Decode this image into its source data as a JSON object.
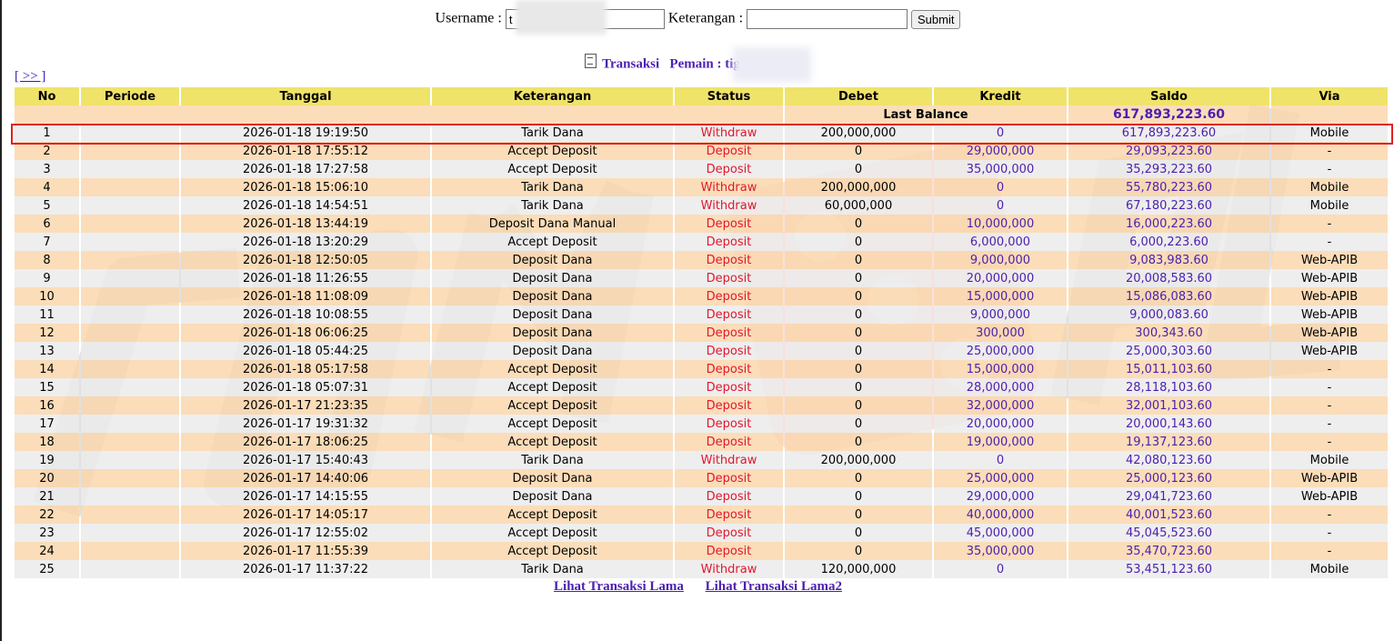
{
  "form": {
    "username_label": "Username :",
    "username_value": "t",
    "keterangan_label": "Keterangan :",
    "keterangan_value": "",
    "submit_label": "Submit"
  },
  "title": {
    "transaksi": "Transaksi",
    "pemain_label": "Pemain : tig"
  },
  "nav": {
    "next_label": "[ >> ]"
  },
  "table": {
    "headers": [
      "No",
      "Periode",
      "Tanggal",
      "Keterangan",
      "Status",
      "Debet",
      "Kredit",
      "Saldo",
      "Via"
    ],
    "last_balance_label": "Last Balance",
    "last_balance_value": "617,893,223.60",
    "rows": [
      {
        "no": "1",
        "periode": "",
        "tanggal": "2026-01-18 19:19:50",
        "ket": "Tarik Dana",
        "status": "Withdraw",
        "debet": "200,000,000",
        "kredit": "0",
        "saldo": "617,893,223.60",
        "via": "Mobile"
      },
      {
        "no": "2",
        "periode": "",
        "tanggal": "2026-01-18 17:55:12",
        "ket": "Accept Deposit",
        "status": "Deposit",
        "debet": "0",
        "kredit": "29,000,000",
        "saldo": "29,093,223.60",
        "via": "-"
      },
      {
        "no": "3",
        "periode": "",
        "tanggal": "2026-01-18 17:27:58",
        "ket": "Accept Deposit",
        "status": "Deposit",
        "debet": "0",
        "kredit": "35,000,000",
        "saldo": "35,293,223.60",
        "via": "-"
      },
      {
        "no": "4",
        "periode": "",
        "tanggal": "2026-01-18 15:06:10",
        "ket": "Tarik Dana",
        "status": "Withdraw",
        "debet": "200,000,000",
        "kredit": "0",
        "saldo": "55,780,223.60",
        "via": "Mobile"
      },
      {
        "no": "5",
        "periode": "",
        "tanggal": "2026-01-18 14:54:51",
        "ket": "Tarik Dana",
        "status": "Withdraw",
        "debet": "60,000,000",
        "kredit": "0",
        "saldo": "67,180,223.60",
        "via": "Mobile"
      },
      {
        "no": "6",
        "periode": "",
        "tanggal": "2026-01-18 13:44:19",
        "ket": "Deposit Dana Manual",
        "status": "Deposit",
        "debet": "0",
        "kredit": "10,000,000",
        "saldo": "16,000,223.60",
        "via": "-"
      },
      {
        "no": "7",
        "periode": "",
        "tanggal": "2026-01-18 13:20:29",
        "ket": "Accept Deposit",
        "status": "Deposit",
        "debet": "0",
        "kredit": "6,000,000",
        "saldo": "6,000,223.60",
        "via": "-"
      },
      {
        "no": "8",
        "periode": "",
        "tanggal": "2026-01-18 12:50:05",
        "ket": "Deposit Dana",
        "status": "Deposit",
        "debet": "0",
        "kredit": "9,000,000",
        "saldo": "9,083,983.60",
        "via": "Web-APIB"
      },
      {
        "no": "9",
        "periode": "",
        "tanggal": "2026-01-18 11:26:55",
        "ket": "Deposit Dana",
        "status": "Deposit",
        "debet": "0",
        "kredit": "20,000,000",
        "saldo": "20,008,583.60",
        "via": "Web-APIB"
      },
      {
        "no": "10",
        "periode": "",
        "tanggal": "2026-01-18 11:08:09",
        "ket": "Deposit Dana",
        "status": "Deposit",
        "debet": "0",
        "kredit": "15,000,000",
        "saldo": "15,086,083.60",
        "via": "Web-APIB"
      },
      {
        "no": "11",
        "periode": "",
        "tanggal": "2026-01-18 10:08:55",
        "ket": "Deposit Dana",
        "status": "Deposit",
        "debet": "0",
        "kredit": "9,000,000",
        "saldo": "9,000,083.60",
        "via": "Web-APIB"
      },
      {
        "no": "12",
        "periode": "",
        "tanggal": "2026-01-18 06:06:25",
        "ket": "Deposit Dana",
        "status": "Deposit",
        "debet": "0",
        "kredit": "300,000",
        "saldo": "300,343.60",
        "via": "Web-APIB"
      },
      {
        "no": "13",
        "periode": "",
        "tanggal": "2026-01-18 05:44:25",
        "ket": "Deposit Dana",
        "status": "Deposit",
        "debet": "0",
        "kredit": "25,000,000",
        "saldo": "25,000,303.60",
        "via": "Web-APIB"
      },
      {
        "no": "14",
        "periode": "",
        "tanggal": "2026-01-18 05:17:58",
        "ket": "Accept Deposit",
        "status": "Deposit",
        "debet": "0",
        "kredit": "15,000,000",
        "saldo": "15,011,103.60",
        "via": "-"
      },
      {
        "no": "15",
        "periode": "",
        "tanggal": "2026-01-18 05:07:31",
        "ket": "Accept Deposit",
        "status": "Deposit",
        "debet": "0",
        "kredit": "28,000,000",
        "saldo": "28,118,103.60",
        "via": "-"
      },
      {
        "no": "16",
        "periode": "",
        "tanggal": "2026-01-17 21:23:35",
        "ket": "Accept Deposit",
        "status": "Deposit",
        "debet": "0",
        "kredit": "32,000,000",
        "saldo": "32,001,103.60",
        "via": "-"
      },
      {
        "no": "17",
        "periode": "",
        "tanggal": "2026-01-17 19:31:32",
        "ket": "Accept Deposit",
        "status": "Deposit",
        "debet": "0",
        "kredit": "20,000,000",
        "saldo": "20,000,143.60",
        "via": "-"
      },
      {
        "no": "18",
        "periode": "",
        "tanggal": "2026-01-17 18:06:25",
        "ket": "Accept Deposit",
        "status": "Deposit",
        "debet": "0",
        "kredit": "19,000,000",
        "saldo": "19,137,123.60",
        "via": "-"
      },
      {
        "no": "19",
        "periode": "",
        "tanggal": "2026-01-17 15:40:43",
        "ket": "Tarik Dana",
        "status": "Withdraw",
        "debet": "200,000,000",
        "kredit": "0",
        "saldo": "42,080,123.60",
        "via": "Mobile"
      },
      {
        "no": "20",
        "periode": "",
        "tanggal": "2026-01-17 14:40:06",
        "ket": "Deposit Dana",
        "status": "Deposit",
        "debet": "0",
        "kredit": "25,000,000",
        "saldo": "25,000,123.60",
        "via": "Web-APIB"
      },
      {
        "no": "21",
        "periode": "",
        "tanggal": "2026-01-17 14:15:55",
        "ket": "Deposit Dana",
        "status": "Deposit",
        "debet": "0",
        "kredit": "29,000,000",
        "saldo": "29,041,723.60",
        "via": "Web-APIB"
      },
      {
        "no": "22",
        "periode": "",
        "tanggal": "2026-01-17 14:05:17",
        "ket": "Accept Deposit",
        "status": "Deposit",
        "debet": "0",
        "kredit": "40,000,000",
        "saldo": "40,001,523.60",
        "via": "-"
      },
      {
        "no": "23",
        "periode": "",
        "tanggal": "2026-01-17 12:55:02",
        "ket": "Accept Deposit",
        "status": "Deposit",
        "debet": "0",
        "kredit": "45,000,000",
        "saldo": "45,045,523.60",
        "via": "-"
      },
      {
        "no": "24",
        "periode": "",
        "tanggal": "2026-01-17 11:55:39",
        "ket": "Accept Deposit",
        "status": "Deposit",
        "debet": "0",
        "kredit": "35,000,000",
        "saldo": "35,470,723.60",
        "via": "-"
      },
      {
        "no": "25",
        "periode": "",
        "tanggal": "2026-01-17 11:37:22",
        "ket": "Tarik Dana",
        "status": "Withdraw",
        "debet": "120,000,000",
        "kredit": "0",
        "saldo": "53,451,123.60",
        "via": "Mobile"
      }
    ]
  },
  "footer": {
    "link1": "Lihat Transaksi Lama",
    "link2": "Lihat Transaksi Lama2"
  },
  "colors": {
    "header_bg": "#f0e36a",
    "row_odd": "#fad5aa",
    "row_even": "#ebebeb",
    "status_red": "#e0182c",
    "accent_purple": "#4b1fb0",
    "highlight_box": "#e02020"
  }
}
